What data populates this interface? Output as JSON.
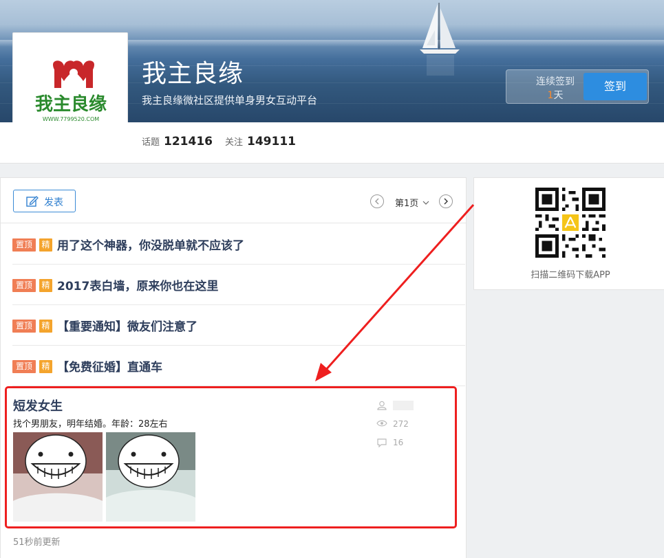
{
  "header": {
    "title": "我主良缘",
    "subtitle": "我主良缘微社区提供单身男女互动平台",
    "logo": {
      "brand_text": "我主良缘",
      "url_text": "WWW.7799520.COM"
    },
    "signin": {
      "prefix": "连续签到",
      "days": "1",
      "suffix": "天",
      "button": "签到"
    }
  },
  "stats": {
    "topics_label": "话题",
    "topics_value": "121416",
    "follow_label": "关注",
    "follow_value": "149111"
  },
  "toolbar": {
    "post_label": "发表",
    "page_label": "第1页"
  },
  "posts": [
    {
      "tag_top": "置顶",
      "tag_featured": "精",
      "title": "用了这个神器，你没脱单就不应该了"
    },
    {
      "tag_top": "置顶",
      "tag_featured": "精",
      "title": "2017表白墙，原来你也在这里"
    },
    {
      "tag_top": "置顶",
      "tag_featured": "精",
      "title": "【重要通知】微友们注意了"
    },
    {
      "tag_top": "置顶",
      "tag_featured": "精",
      "title": "【免费征婚】直通车"
    }
  ],
  "featured_post": {
    "title": "短发女生",
    "description": "找个男朋友，明年结婚。年龄：28左右",
    "views": "272",
    "comments": "16",
    "updated": "51秒前更新"
  },
  "sidebar": {
    "qr_caption": "扫描二维码下载APP"
  },
  "colors": {
    "accent_blue": "#2d8de0",
    "tag_top": "#f07e55",
    "tag_featured": "#f4a42c",
    "highlight_red": "#ee1f1f",
    "title_navy": "#2e3e5c"
  }
}
